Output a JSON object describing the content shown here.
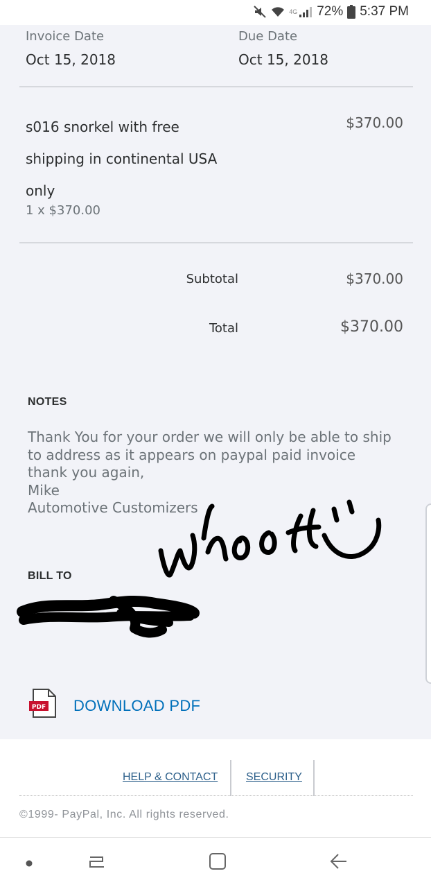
{
  "status_bar": {
    "battery_percent": "72%",
    "time": "5:37 PM",
    "network": "4G"
  },
  "invoice": {
    "invoice_date_label": "Invoice Date",
    "invoice_date": "Oct 15, 2018",
    "due_date_label": "Due Date",
    "due_date": "Oct 15, 2018"
  },
  "line_item": {
    "description_lines": [
      "s016 snorkel with free",
      "shipping in continental USA",
      "only"
    ],
    "quantity_price": "1  x $370.00",
    "amount": "$370.00"
  },
  "summary": {
    "subtotal_label": "Subtotal",
    "subtotal": "$370.00",
    "total_label": "Total",
    "total": "$370.00"
  },
  "notes": {
    "heading": "NOTES",
    "text": "Thank You for your order we will only be able to ship\nto address as it appears on paypal paid invoice\nthank you again,\nMike\nAutomotive Customizers"
  },
  "handwriting": "whoot",
  "bill_to": {
    "heading": "BILL TO"
  },
  "download": {
    "icon_label": "PDF",
    "label": "DOWNLOAD PDF"
  },
  "footer": {
    "links": [
      "HELP & CONTACT",
      "SECURITY"
    ],
    "copyright": "©1999- PayPal, Inc. All rights reserved."
  },
  "colors": {
    "link": "#0070ba",
    "background": "#f2f3f8",
    "pdf_red": "#c8102e"
  }
}
